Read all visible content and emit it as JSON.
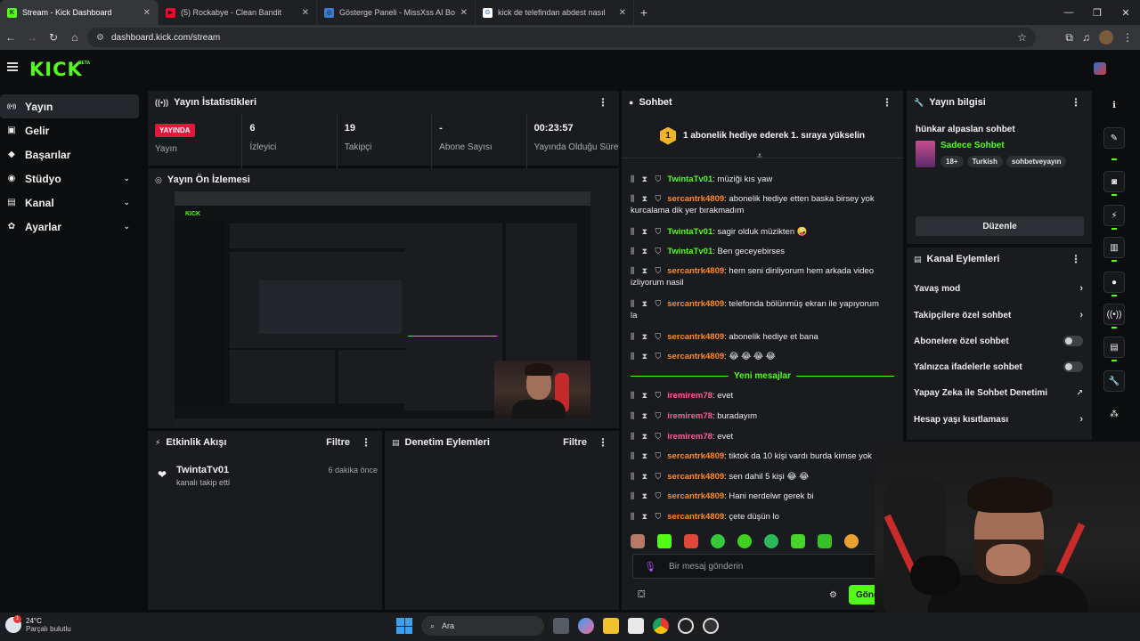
{
  "browser": {
    "tabs": [
      {
        "label": "Stream - Kick Dashboard",
        "fav_color": "#53fc18",
        "fav_char": "K",
        "active": true
      },
      {
        "label": "(5) Rockabye - Clean Bandit",
        "fav_color": "#ff0033",
        "fav_char": "▶",
        "active": false
      },
      {
        "label": "Gösterge Paneli - MissXss AI Bo",
        "fav_color": "#3a7bd5",
        "fav_char": "◎",
        "active": false
      },
      {
        "label": "kick de telefindan abdest nasıl",
        "fav_color": "#ffffff",
        "fav_char": "G",
        "active": false
      }
    ],
    "url": "dashboard.kick.com/stream"
  },
  "header": {
    "logo": "KICK",
    "beta": "BETA"
  },
  "sidebar": {
    "items": [
      {
        "label": "Yayın",
        "icon": "broadcast-icon",
        "glyph": "((•))",
        "active": true,
        "expand": false
      },
      {
        "label": "Gelir",
        "icon": "money-icon",
        "glyph": "▣",
        "active": false,
        "expand": false
      },
      {
        "label": "Başarılar",
        "icon": "trophy-icon",
        "glyph": "◆",
        "active": false,
        "expand": false
      },
      {
        "label": "Stüdyo",
        "icon": "studio-icon",
        "glyph": "◉",
        "active": false,
        "expand": true
      },
      {
        "label": "Kanal",
        "icon": "channel-icon",
        "glyph": "▤",
        "active": false,
        "expand": true
      },
      {
        "label": "Ayarlar",
        "icon": "gear-icon",
        "glyph": "✿",
        "active": false,
        "expand": true
      }
    ]
  },
  "stats_panel": {
    "title": "Yayın İstatistikleri",
    "live_badge": "YAYINDA",
    "status_label": "Yayın",
    "stats": [
      {
        "value": "6",
        "label": "İzleyici"
      },
      {
        "value": "19",
        "label": "Takipçi"
      },
      {
        "value": "-",
        "label": "Abone Sayısı"
      },
      {
        "value": "00:23:57",
        "label": "Yayında Olduğu Süre"
      }
    ]
  },
  "preview_panel": {
    "title": "Yayın Ön İzlemesi"
  },
  "activity_panel": {
    "title": "Etkinlik Akışı",
    "filter": "Filtre",
    "events": [
      {
        "user": "TwintaTv01",
        "action": "kanalı takip etti",
        "time": "6 dakika önce"
      }
    ]
  },
  "moderation_panel": {
    "title": "Denetim Eylemleri",
    "filter": "Filtre"
  },
  "chat": {
    "title": "Sohbet",
    "pinned": "1 abonelik hediye ederek 1. sıraya yükselin",
    "pin_rank": "1",
    "messages": [
      {
        "user": "TwintaTv01",
        "color": "green",
        "text": "müziği kıs yaw"
      },
      {
        "user": "sercantrk4809",
        "color": "orange",
        "text": "abonelik hediye etten baska birsey yok kurcalama dik yer bırakmadım"
      },
      {
        "user": "TwintaTv01",
        "color": "green",
        "text": "sagir olduk müzikten 🤪"
      },
      {
        "user": "TwintaTv01",
        "color": "green",
        "text": "Ben geceyebirses"
      },
      {
        "user": "sercantrk4809",
        "color": "orange",
        "text": "hem seni dinliyorum hem arkada video izliyorum nasil"
      },
      {
        "user": "sercantrk4809",
        "color": "orange",
        "text": "telefonda bölünmüş ekran ile yapıyorum la"
      },
      {
        "user": "sercantrk4809",
        "color": "orange",
        "text": "abonelik hediye et bana"
      },
      {
        "user": "sercantrk4809",
        "color": "orange",
        "text": "😂 😂 😂 😂"
      },
      {
        "user": "iremirem78",
        "color": "pink",
        "text": "evet"
      },
      {
        "user": "iremirem78",
        "color": "pink",
        "text": "buradayım"
      },
      {
        "user": "iremirem78",
        "color": "pink",
        "text": "evet"
      },
      {
        "user": "sercantrk4809",
        "color": "orange",
        "text": "tiktok da 10 kişi vardı burda kimse yok"
      },
      {
        "user": "sercantrk4809",
        "color": "orange",
        "text": "sen dahil 5 kişi 😂 😂"
      },
      {
        "user": "sercantrk4809",
        "color": "orange",
        "text": "Hani nerdelwr gerek bi"
      },
      {
        "user": "sercantrk4809",
        "color": "orange",
        "text": "çete düşün lo"
      }
    ],
    "new_messages": "Yeni mesajlar",
    "input_placeholder": "Bir mesaj gönderin",
    "send_label": "Gönder"
  },
  "stream_info": {
    "title": "Yayın bilgisi",
    "stream_title": "hünkar alpaslan sohbet",
    "category": "Sadece Sohbet",
    "tags": [
      "18+",
      "Turkish",
      "sohbetveyayın"
    ],
    "edit_label": "Düzenle"
  },
  "channel_actions": {
    "title": "Kanal Eylemleri",
    "items": [
      {
        "label": "Yavaş mod",
        "control": "chevron"
      },
      {
        "label": "Takipçilere özel sohbet",
        "control": "chevron"
      },
      {
        "label": "Abonelere özel sohbet",
        "control": "toggle"
      },
      {
        "label": "Yalnızca ifadelerle sohbet",
        "control": "toggle"
      },
      {
        "label": "Yapay Zeka ile Sohbet Denetimi",
        "control": "external"
      },
      {
        "label": "Hesap yaşı kısıtlaması",
        "control": "chevron"
      }
    ]
  },
  "taskbar": {
    "temperature": "24°C",
    "weather": "Parçalı bulutlu",
    "weather_badge": "1",
    "search": "Ara"
  },
  "colors": {
    "brand": "#53fc18",
    "live": "#e4173b",
    "panel": "#191b1f"
  }
}
